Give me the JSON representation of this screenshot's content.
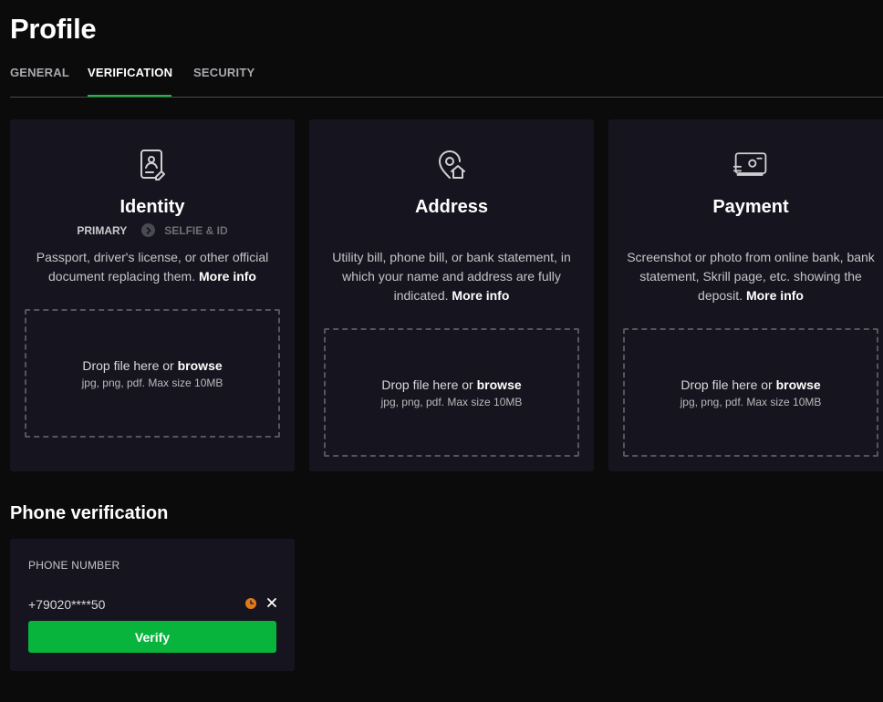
{
  "page": {
    "title": "Profile"
  },
  "tabs": [
    {
      "label": "GENERAL",
      "active": false
    },
    {
      "label": "VERIFICATION",
      "active": true
    },
    {
      "label": "SECURITY",
      "active": false
    }
  ],
  "cards": {
    "identity": {
      "icon": "id-document-icon",
      "title": "Identity",
      "steps": {
        "first": "PRIMARY",
        "second": "SELFIE & ID"
      },
      "description": "Passport, driver's license, or other official document replacing them.",
      "more_info": "More info",
      "drop_prefix": "Drop file here or",
      "drop_browse": "browse",
      "drop_hint": "jpg, png, pdf. Max size 10MB"
    },
    "address": {
      "icon": "location-home-icon",
      "title": "Address",
      "description": "Utility bill, phone bill, or bank statement, in which your name and address are fully indicated.",
      "more_info": "More info",
      "drop_prefix": "Drop file here or",
      "drop_browse": "browse",
      "drop_hint": "jpg, png, pdf. Max size 10MB"
    },
    "payment": {
      "icon": "payment-card-icon",
      "title": "Payment",
      "description": "Screenshot or photo from online bank, bank statement, Skrill page, etc. showing the deposit.",
      "more_info": "More info",
      "drop_prefix": "Drop file here or",
      "drop_browse": "browse",
      "drop_hint": "jpg, png, pdf. Max size 10MB"
    }
  },
  "phone": {
    "section_title": "Phone verification",
    "label": "PHONE NUMBER",
    "value": "+79020****50",
    "status_icon": "pending-clock-icon",
    "verify_label": "Verify"
  },
  "colors": {
    "accent": "#08b43c",
    "tab_underline": "#1fb83f",
    "card_bg": "#16151f",
    "page_bg": "#0b0b0c",
    "pending": "#e0781c"
  }
}
